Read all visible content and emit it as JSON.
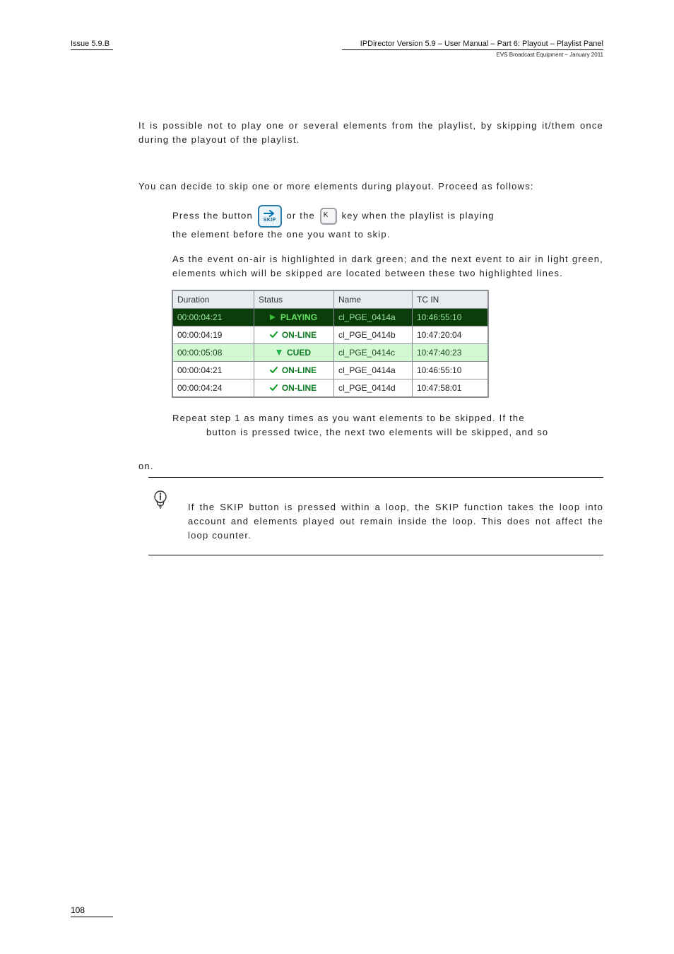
{
  "header": {
    "issue": "Issue 5.9.B",
    "title": "IPDirector Version 5.9 – User Manual – Part 6: Playout – Playlist Panel",
    "sub": "EVS Broadcast Equipment – January 2011"
  },
  "body": {
    "intro": "It is possible not to play one or several elements from the playlist, by skipping it/them once during the playout of the playlist.",
    "proceed": "You can decide to skip one or more elements during playout. Proceed as follows:",
    "step1a": "Press the ",
    "step1b": " button ",
    "step1c": " or the ",
    "step1d": " key when the playlist is playing",
    "step1e": "the element before the one you want to skip.",
    "skip_btn_label": "SKIP",
    "k_key_label": "K",
    "step2": "As the event on-air is highlighted in dark green; and the next event to air in light green, elements which will be skipped are located between these two highlighted lines.",
    "repeat_a": "Repeat step 1 as many times as you want elements to be skipped. If the",
    "repeat_b": "button is pressed twice, the next two elements will be skipped, and so",
    "repeat_c": "on."
  },
  "table": {
    "headers": {
      "duration": "Duration",
      "status": "Status",
      "name": "Name",
      "tcin": "TC IN"
    },
    "rows": [
      {
        "duration": "00:00:04:21",
        "status": "PLAYING",
        "name": "cl_PGE_0414a",
        "tcin": "10:46:55:10",
        "kind": "play"
      },
      {
        "duration": "00:00:04:19",
        "status": "ON-LINE",
        "name": "cl_PGE_0414b",
        "tcin": "10:47:20:04",
        "kind": "online"
      },
      {
        "duration": "00:00:05:08",
        "status": "CUED",
        "name": "cl_PGE_0414c",
        "tcin": "10:47:40:23",
        "kind": "cued"
      },
      {
        "duration": "00:00:04:21",
        "status": "ON-LINE",
        "name": "cl_PGE_0414a",
        "tcin": "10:46:55:10",
        "kind": "online"
      },
      {
        "duration": "00:00:04:24",
        "status": "ON-LINE",
        "name": "cl_PGE_0414d",
        "tcin": "10:47:58:01",
        "kind": "online"
      }
    ]
  },
  "note": {
    "text": "If the SKIP button is pressed within a loop, the SKIP function takes the loop into account and elements played out remain inside the loop. This does not affect the loop counter."
  },
  "footer": {
    "page": "108"
  }
}
